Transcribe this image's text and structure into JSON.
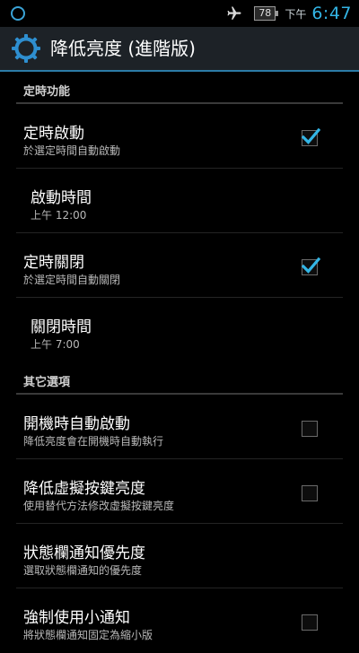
{
  "status_bar": {
    "battery": "78",
    "ampm": "下午",
    "time": "6:47"
  },
  "app": {
    "title": "降低亮度 (進階版)"
  },
  "sections": [
    {
      "title": "定時功能",
      "items": [
        {
          "title": "定時啟動",
          "summary": "於選定時間自動啟動",
          "checked": true
        },
        {
          "title": "啟動時間",
          "summary": "上午 12:00"
        },
        {
          "title": "定時關閉",
          "summary": "於選定時間自動關閉",
          "checked": true
        },
        {
          "title": "關閉時間",
          "summary": "上午 7:00"
        }
      ]
    },
    {
      "title": "其它選項",
      "items": [
        {
          "title": "開機時自動啟動",
          "summary": "降低亮度會在開機時自動執行",
          "checked": false
        },
        {
          "title": "降低虛擬按鍵亮度",
          "summary": "使用替代方法修改虛擬按鍵亮度",
          "checked": false
        },
        {
          "title": "狀態欄通知優先度",
          "summary": "選取狀態欄通知的優先度"
        },
        {
          "title": "強制使用小通知",
          "summary": "將狀態欄通知固定為縮小版",
          "checked": false
        }
      ]
    }
  ],
  "colors": {
    "accent": "#33b5e5",
    "action_bar": "#1d2227",
    "background": "#000000"
  }
}
